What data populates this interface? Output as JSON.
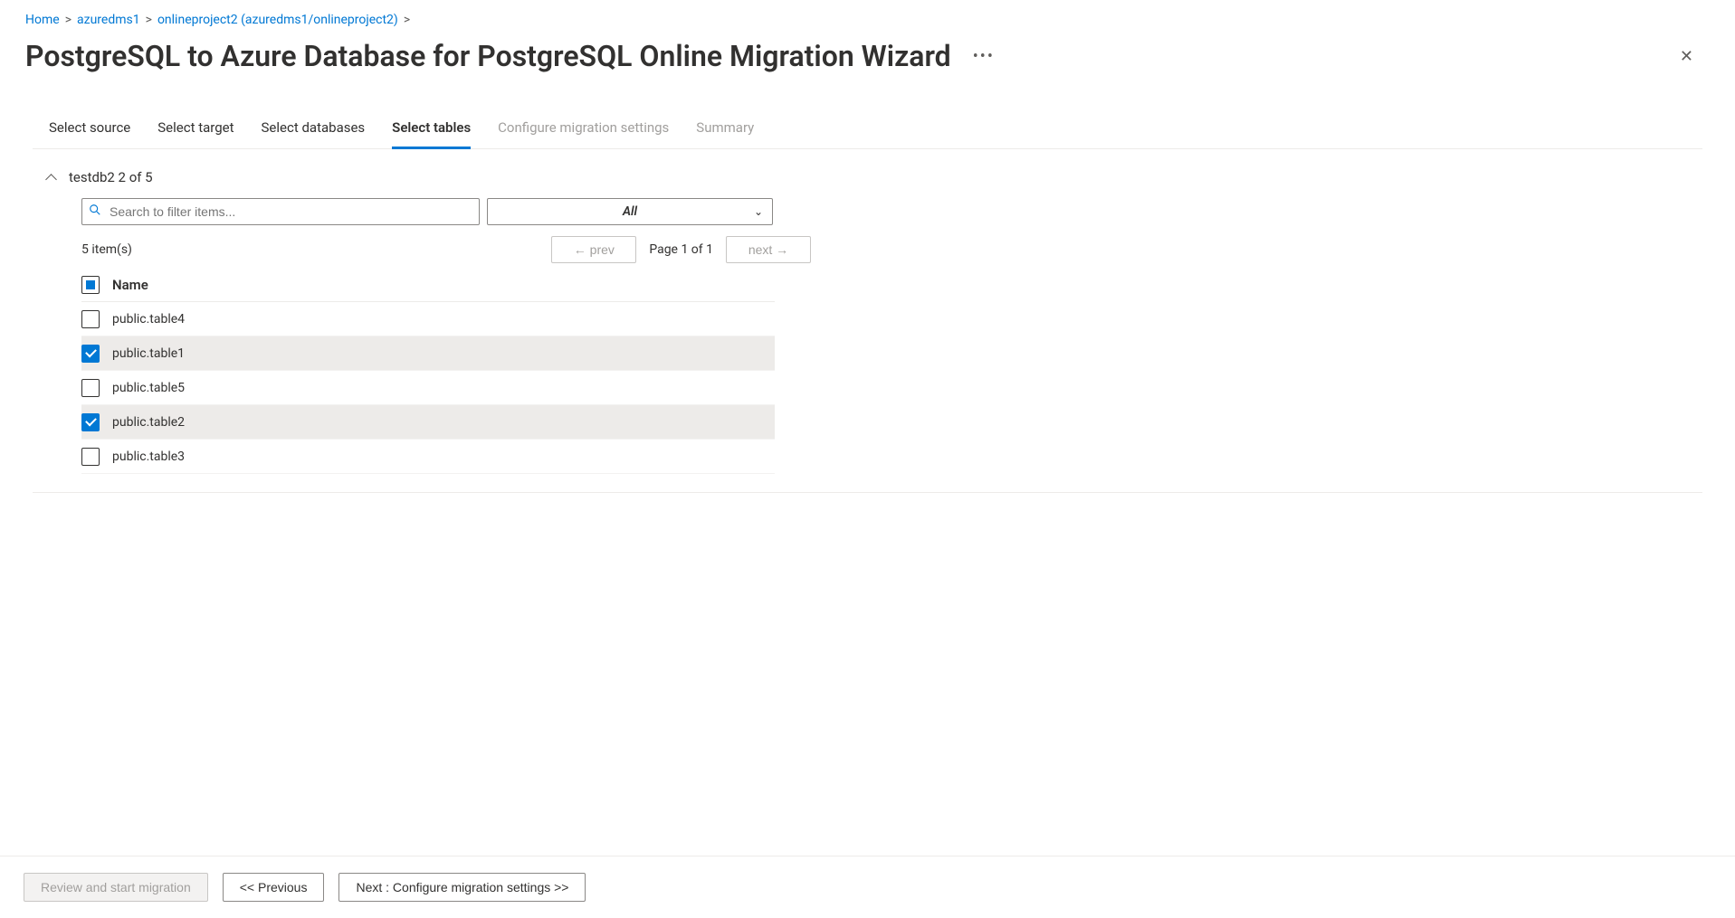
{
  "breadcrumb": {
    "items": [
      {
        "label": "Home"
      },
      {
        "label": "azuredms1"
      },
      {
        "label": "onlineproject2 (azuredms1/onlineproject2)"
      }
    ]
  },
  "header": {
    "title": "PostgreSQL to Azure Database for PostgreSQL Online Migration Wizard"
  },
  "tabs": [
    {
      "label": "Select source",
      "state": "enabled"
    },
    {
      "label": "Select target",
      "state": "enabled"
    },
    {
      "label": "Select databases",
      "state": "enabled"
    },
    {
      "label": "Select tables",
      "state": "active"
    },
    {
      "label": "Configure migration settings",
      "state": "disabled"
    },
    {
      "label": "Summary",
      "state": "disabled"
    }
  ],
  "db_section": {
    "title": "testdb2 2 of 5",
    "search_placeholder": "Search to filter items...",
    "filter_value": "All",
    "item_count_text": "5 item(s)",
    "prev_label": "← prev",
    "page_info": "Page 1 of 1",
    "next_label": "next →",
    "header_checkbox_state": "indeterminate",
    "column_header": "Name",
    "rows": [
      {
        "name": "public.table4",
        "checked": false
      },
      {
        "name": "public.table1",
        "checked": true
      },
      {
        "name": "public.table5",
        "checked": false
      },
      {
        "name": "public.table2",
        "checked": true
      },
      {
        "name": "public.table3",
        "checked": false
      }
    ]
  },
  "footer": {
    "review_label": "Review and start migration",
    "previous_label": "<< Previous",
    "next_label": "Next : Configure migration settings >>"
  }
}
